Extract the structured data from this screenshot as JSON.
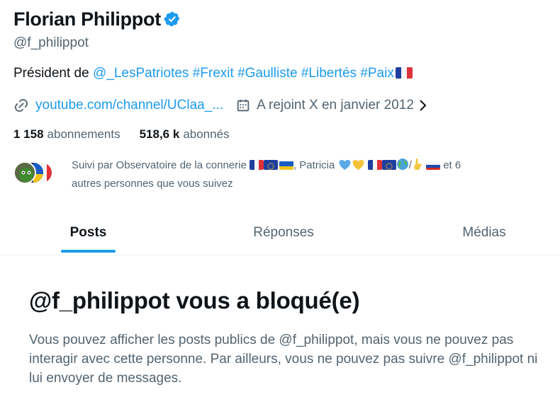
{
  "profile": {
    "name": "Florian Philippot",
    "handle": "@f_philippot",
    "bio_prefix": "Président de ",
    "bio_links": [
      "@_LesPatriotes",
      "#Frexit",
      "#Gaulliste",
      "#Libertés",
      "#Paix"
    ],
    "website": "youtube.com/channel/UClaa_...",
    "joined": "A rejoint X en janvier 2012",
    "following_count": "1 158",
    "following_label": "abonnements",
    "followers_count": "518,6 k",
    "followers_label": "abonnés",
    "followed_by_prefix": "Suivi par Observatoire de la connerie",
    "followed_by_middle": ", Patricia",
    "followed_by_suffix": "et 6",
    "followed_by_line2": "autres personnes que vous suivez"
  },
  "tabs": [
    {
      "label": "Posts",
      "active": true
    },
    {
      "label": "Réponses",
      "active": false
    },
    {
      "label": "Médias",
      "active": false
    }
  ],
  "blocked": {
    "title": "@f_philippot vous a bloqué(e)",
    "message": "Vous pouvez afficher les posts publics de @f_philippot, mais vous ne pouvez pas interagir avec cette personne. Par ailleurs, vous ne pouvez pas suivre @f_philippot ni lui envoyer de messages."
  },
  "colors": {
    "accent": "#1d9bf0",
    "text_primary": "#0f1419",
    "text_secondary": "#536471"
  },
  "icons": [
    "verified-badge-icon",
    "link-icon",
    "calendar-icon",
    "chevron-right-icon"
  ]
}
